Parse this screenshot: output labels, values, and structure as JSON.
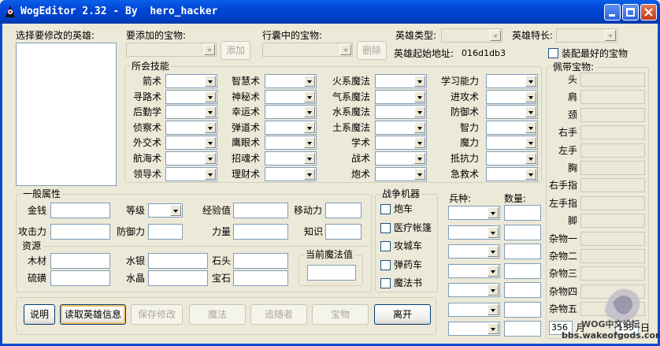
{
  "window": {
    "title": "WogEditor 2.32 - By  hero_hacker"
  },
  "hero_list": {
    "label": "选择要修改的英雄:"
  },
  "add_artifact": {
    "label": "要添加的宝物:",
    "button": "添加"
  },
  "camp_artifact": {
    "label": "行囊中的宝物:",
    "button": "删除"
  },
  "hero_type": {
    "label": "英雄类型:"
  },
  "hero_specialty": {
    "label": "英雄特长:"
  },
  "hero_address": {
    "label": "英雄起始地址:",
    "value": "016d1db3"
  },
  "equip_best": {
    "label": "装配最好的宝物"
  },
  "skills": {
    "title": "所会技能",
    "col1": [
      "箭术",
      "寻路术",
      "后勤学",
      "侦察术",
      "外交术",
      "航海术",
      "领导术"
    ],
    "col2": [
      "智慧术",
      "神秘术",
      "幸运术",
      "弹道术",
      "鹰眼术",
      "招魂术",
      "理财术"
    ],
    "col3": [
      "火系魔法",
      "气系魔法",
      "水系魔法",
      "土系魔法",
      "学术",
      "战术",
      "炮术"
    ],
    "col4": [
      "学习能力",
      "进攻术",
      "防御术",
      "智力",
      "魔力",
      "抵抗力",
      "急救术"
    ]
  },
  "general": {
    "title": "一般属性",
    "gold": "金钱",
    "level": "等级",
    "experience": "经验值",
    "movement": "移动力",
    "attack": "攻击力",
    "defense": "防御力",
    "power": "力量",
    "knowledge": "知识"
  },
  "resources": {
    "title": "资源",
    "wood": "木材",
    "mercury": "水银",
    "ore": "石头",
    "sulfur": "硫磺",
    "crystal": "水晶",
    "gems": "宝石",
    "mana_title": "当前魔法值"
  },
  "war_machines": {
    "title": "战争机器",
    "items": [
      "炮车",
      "医疗帐篷",
      "攻城车",
      "弹药车",
      "魔法书"
    ]
  },
  "troops": {
    "type_label": "兵种:",
    "count_label": "数量:"
  },
  "equipped": {
    "title": "佩带宝物:",
    "slots": [
      "头",
      "肩",
      "颈",
      "右手",
      "左手",
      "胸",
      "右手指",
      "左手指",
      "脚",
      "杂物一",
      "杂物二",
      "杂物三",
      "杂物四",
      "杂物五"
    ]
  },
  "date": {
    "value": "356",
    "month": "月",
    "week_value": "135",
    "day": "日"
  },
  "buttons": {
    "help": "说明",
    "read": "读取英雄信息",
    "save": "保存修改",
    "magic": "魔法",
    "followers": "追随者",
    "artifacts": "宝物",
    "exit": "离开"
  },
  "watermark": {
    "line1": "WOG中文论坛",
    "line2": "bbs.wakeofgods.com"
  },
  "colors": {
    "titlebar": "#0046d5",
    "face": "#ece9d8",
    "border": "#7f9db9"
  }
}
